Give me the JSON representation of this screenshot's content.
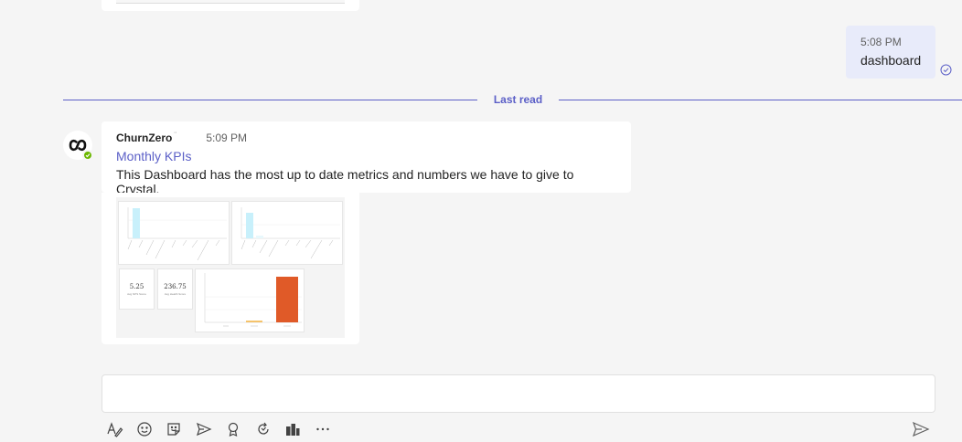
{
  "outgoing": {
    "time": "5:08 PM",
    "text": "dashboard"
  },
  "divider": {
    "label": "Last read"
  },
  "incoming": {
    "sender": "ChurnZero",
    "sender_suffix": "¨",
    "time": "5:09 PM",
    "link": "Monthly KPIs",
    "text": "This Dashboard has the most up to date metrics and numbers we have to give to Crystal."
  },
  "attachment": {
    "kpi1": {
      "value": "5.25",
      "caption": "Avg NPS Score"
    },
    "kpi2": {
      "value": "236.75",
      "caption": "Avg Health Score"
    }
  },
  "compose": {
    "placeholder": ""
  },
  "toolbar": [
    "format-icon",
    "emoji-icon",
    "sticker-icon",
    "schedule-send-icon",
    "praise-icon",
    "loop-icon",
    "apps-icon",
    "more-icon"
  ],
  "colors": {
    "accent": "#5b5fc7",
    "bar_orange": "#e05a28",
    "bar_light": "#c8f0fb",
    "presence": "#6bb700"
  }
}
